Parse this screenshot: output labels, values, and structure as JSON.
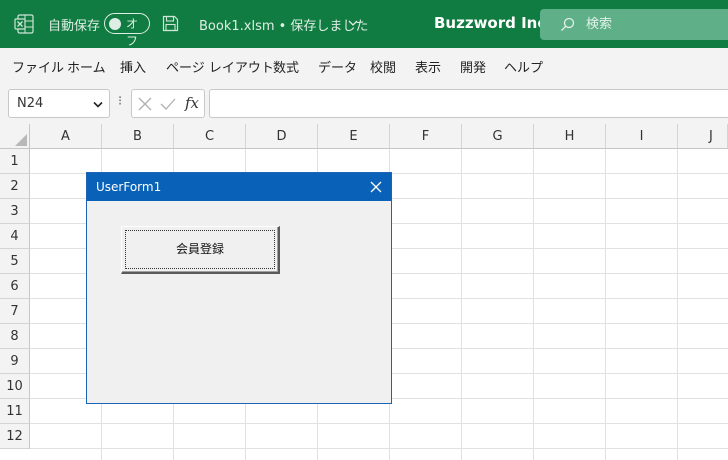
{
  "titlebar": {
    "autosave_label": "自動保存",
    "autosave_state": "オフ",
    "filename": "Book1.xlsm • 保存しました",
    "company": "Buzzword Inc.",
    "search_placeholder": "検索",
    "bg_color": "#107c41"
  },
  "menu": [
    "ファイル",
    "ホーム",
    "挿入",
    "ページ レイアウト",
    "数式",
    "データ",
    "校閲",
    "表示",
    "開発",
    "ヘルプ"
  ],
  "formulabar": {
    "name_box": "N24",
    "fx_label": "fx",
    "formula": ""
  },
  "grid": {
    "columns": [
      "A",
      "B",
      "C",
      "D",
      "E",
      "F",
      "G",
      "H",
      "I",
      "J"
    ],
    "rows": [
      "1",
      "2",
      "3",
      "4",
      "5",
      "6",
      "7",
      "8",
      "9",
      "10",
      "11",
      "12"
    ]
  },
  "userform": {
    "title": "UserForm1",
    "button_label": "会員登録",
    "title_color": "#0a62b8"
  }
}
